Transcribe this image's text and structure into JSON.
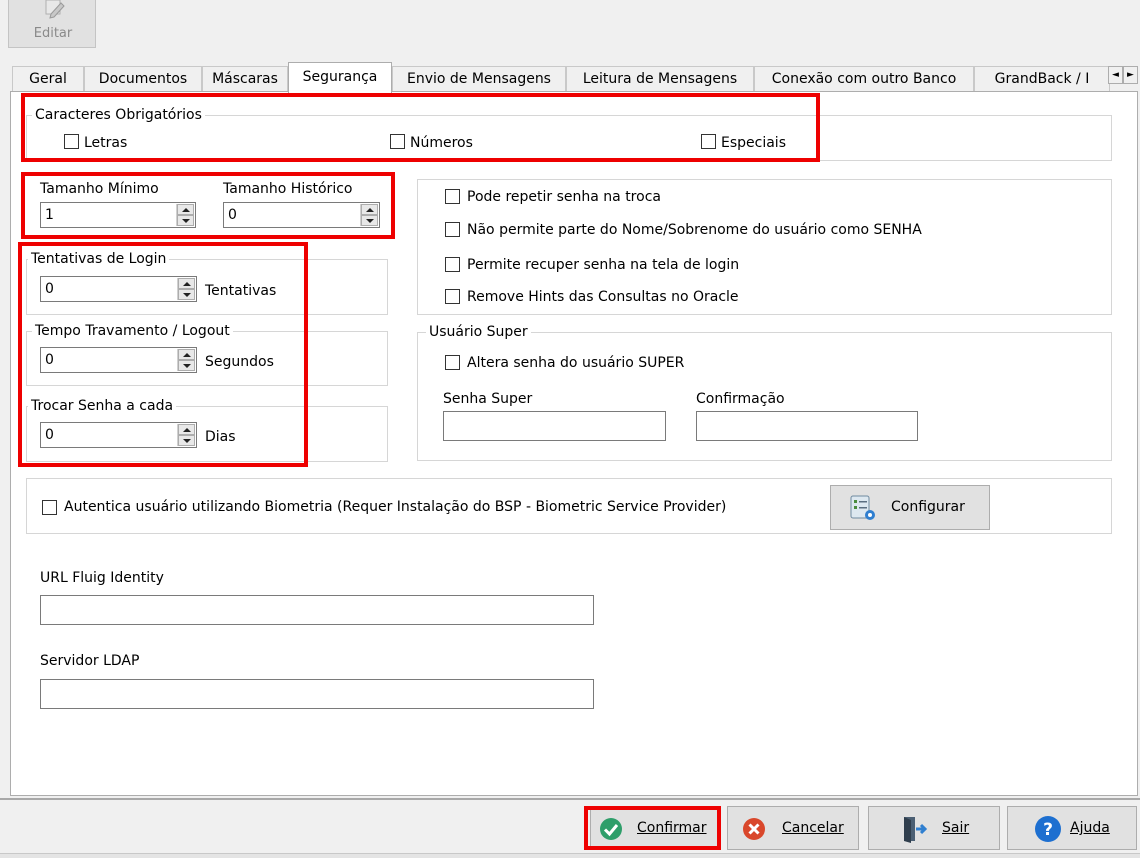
{
  "toolbar": {
    "edit_label": "Editar"
  },
  "tabs": [
    "Geral",
    "Documentos",
    "Máscaras",
    "Segurança",
    "Envio de Mensagens",
    "Leitura de Mensagens",
    "Conexão com outro Banco",
    "GrandBack / I"
  ],
  "tab_scroll": {
    "left": "◄",
    "right": "►"
  },
  "caracteres": {
    "title": "Caracteres Obrigatórios",
    "letras": "Letras",
    "numeros": "Números",
    "especiais": "Especiais"
  },
  "tamanho": {
    "minimo_label": "Tamanho Mínimo",
    "minimo_value": "1",
    "historico_label": "Tamanho Histórico",
    "historico_value": "0"
  },
  "tentativas": {
    "title": "Tentativas de Login",
    "value": "0",
    "unit": "Tentativas"
  },
  "tempo": {
    "title": "Tempo Travamento / Logout",
    "value": "0",
    "unit": "Segundos"
  },
  "trocar": {
    "title": "Trocar Senha a cada",
    "value": "0",
    "unit": "Dias"
  },
  "options": {
    "repetir": "Pode repetir senha na troca",
    "nome": "Não permite parte do Nome/Sobrenome do usuário como SENHA",
    "recuperar": "Permite recuper senha na tela de login",
    "hints": "Remove Hints das Consultas no Oracle"
  },
  "super": {
    "title": "Usuário Super",
    "altera": "Altera senha do usuário SUPER",
    "senha_label": "Senha Super",
    "confirmacao_label": "Confirmação"
  },
  "biometria": {
    "label": "Autentica usuário utilizando Biometria (Requer Instalação do BSP - Biometric Service Provider)",
    "configurar": "Configurar"
  },
  "fluig": {
    "label": "URL Fluig Identity"
  },
  "ldap": {
    "label": "Servidor LDAP"
  },
  "buttons": {
    "confirmar": "Confirmar",
    "cancelar": "Cancelar",
    "sair": "Sair",
    "ajuda": "Ajuda"
  },
  "colors": {
    "highlight": "#ee0000",
    "confirm_green": "#2e9e6a",
    "cancel_red": "#d9472b",
    "help_blue": "#1d6fd0"
  }
}
